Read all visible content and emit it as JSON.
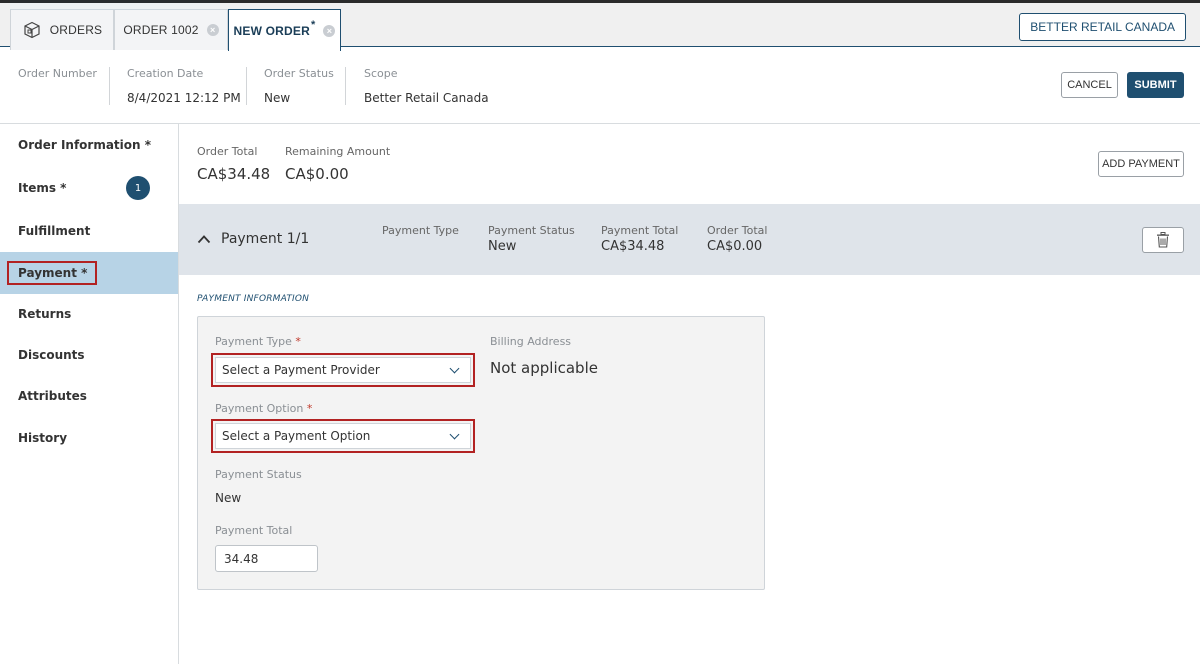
{
  "tabs": [
    {
      "label": "ORDERS",
      "icon": "box-icon"
    },
    {
      "label": "ORDER 1002"
    },
    {
      "label": "NEW ORDER",
      "modified": "*"
    }
  ],
  "scope_button": "BETTER RETAIL CANADA",
  "header": {
    "order_number_label": "Order Number",
    "creation_date_label": "Creation Date",
    "creation_date": "8/4/2021 12:12 PM",
    "order_status_label": "Order Status",
    "order_status": "New",
    "scope_label": "Scope",
    "scope": "Better Retail Canada",
    "cancel": "CANCEL",
    "submit": "SUBMIT"
  },
  "sidebar": {
    "items": [
      {
        "label": "Order Information *"
      },
      {
        "label": "Items *",
        "badge": "1"
      },
      {
        "label": "Fulfillment"
      },
      {
        "label": "Payment *",
        "active": true
      },
      {
        "label": "Returns"
      },
      {
        "label": "Discounts"
      },
      {
        "label": "Attributes"
      },
      {
        "label": "History"
      }
    ]
  },
  "summary": {
    "order_total_label": "Order Total",
    "order_total": "CA$34.48",
    "remaining_label": "Remaining Amount",
    "remaining": "CA$0.00",
    "add_payment": "ADD PAYMENT"
  },
  "payment_bar": {
    "title": "Payment 1/1",
    "type_label": "Payment Type",
    "type_value": "",
    "status_label": "Payment Status",
    "status_value": "New",
    "total_label": "Payment Total",
    "total_value": "CA$34.48",
    "order_total_label": "Order Total",
    "order_total_value": "CA$0.00"
  },
  "payment_info": {
    "section_title": "PAYMENT INFORMATION",
    "type_label": "Payment Type",
    "type_placeholder": "Select a Payment Provider",
    "option_label": "Payment Option",
    "option_placeholder": "Select a Payment Option",
    "required_mark": "*",
    "status_label": "Payment Status",
    "status_value": "New",
    "total_label": "Payment Total",
    "total_value": "34.48",
    "billing_label": "Billing Address",
    "billing_value": "Not applicable"
  },
  "colors": {
    "accent": "#1f4f70",
    "active_nav": "#b7d3e6",
    "highlight": "#b22222",
    "required": "#c0392b"
  }
}
